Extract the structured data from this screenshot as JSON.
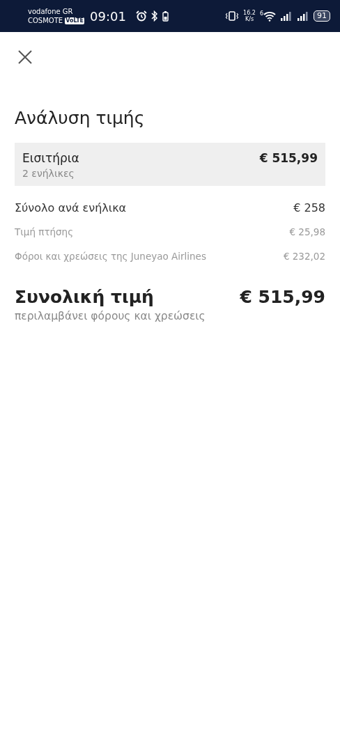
{
  "status_bar": {
    "carrier_1": "vodafone GR",
    "carrier_2": "COSMOTE",
    "volte_badge": "VoLTE",
    "time": "09:01",
    "speed_value": "16.2",
    "speed_unit": "K/s",
    "wifi_label": "6",
    "battery": "91"
  },
  "title": "Ανάλυση τιμής",
  "tickets": {
    "label": "Εισιτήρια",
    "sublabel": "2 ενήλικες",
    "amount": "€ 515,99"
  },
  "breakdown": [
    {
      "kind": "main",
      "label": "Σύνολο ανά ενήλικα",
      "amount": "€ 258"
    },
    {
      "kind": "sub",
      "label": "Τιμή πτήσης",
      "amount": "€ 25,98"
    },
    {
      "kind": "sub",
      "label": "Φόροι και χρεώσεις της Juneyao Airlines",
      "amount": "€ 232,02"
    }
  ],
  "total": {
    "label": "Συνολική τιμή",
    "amount": "€ 515,99",
    "note": "περιλαμβάνει φόρους και χρεώσεις"
  }
}
